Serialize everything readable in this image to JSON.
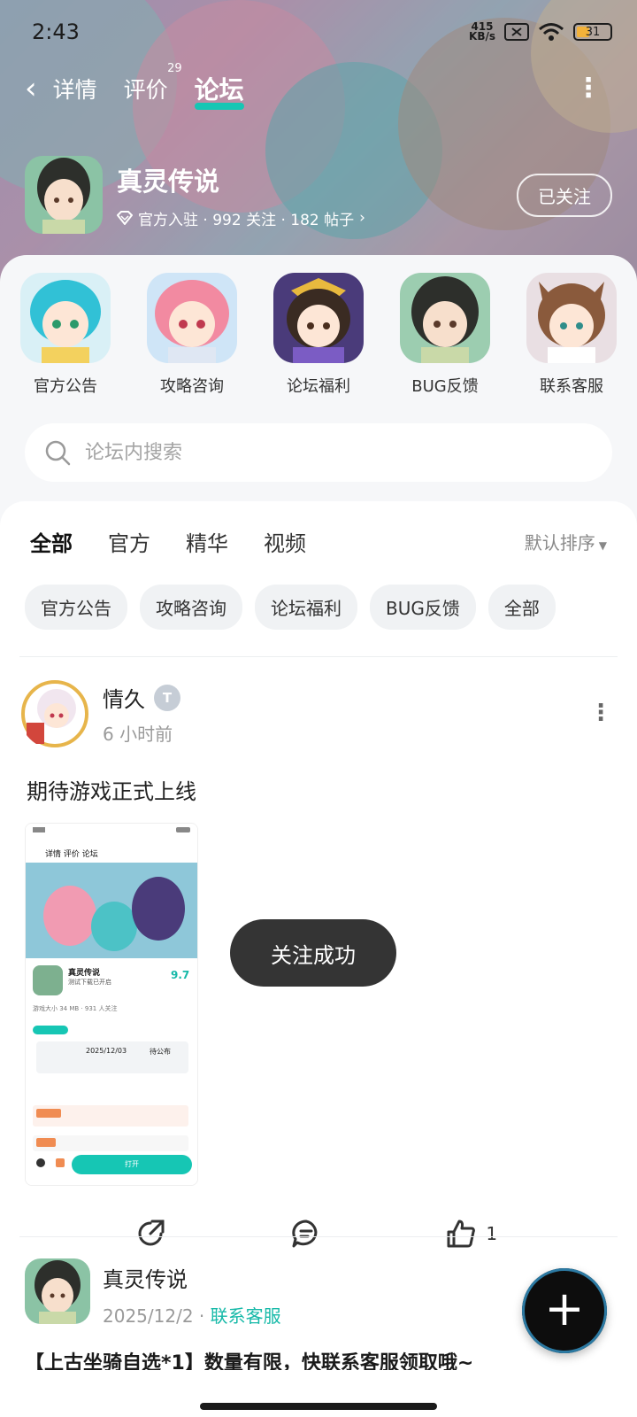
{
  "status_bar": {
    "time": "2:43",
    "net_speed_value": "415",
    "net_speed_unit": "KB/s",
    "battery": "31"
  },
  "nav": {
    "back_icon": "chevron-left-icon",
    "tabs": [
      {
        "label": "详情"
      },
      {
        "label": "评价",
        "count": "29"
      },
      {
        "label": "论坛",
        "active": true
      }
    ],
    "more_icon": "more-vertical-icon"
  },
  "game": {
    "title": "真灵传说",
    "meta": "官方入驻 · 992 关注 · 182 帖子",
    "follow_button": "已关注"
  },
  "categories": [
    {
      "label": "官方公告"
    },
    {
      "label": "攻略咨询"
    },
    {
      "label": "论坛福利"
    },
    {
      "label": "BUG反馈"
    },
    {
      "label": "联系客服"
    }
  ],
  "search": {
    "placeholder": "论坛内搜索"
  },
  "feed": {
    "tabs": [
      "全部",
      "官方",
      "精华",
      "视频"
    ],
    "sort_label": "默认排序",
    "chips": [
      "官方公告",
      "攻略咨询",
      "论坛福利",
      "BUG反馈",
      "全部"
    ]
  },
  "post1": {
    "author": "情久",
    "badge": "T",
    "time": "6 小时前",
    "text": "期待游戏正式上线",
    "like_count": "1",
    "screenshot": {
      "tabs": "详情  评价  论坛",
      "title": "真灵传说",
      "subtitle": "测试下载已开启",
      "score": "9.7",
      "size": "游戏大小 34 MB · 931 人关注",
      "date": "2025/12/03",
      "date_right": "待公布",
      "button": "打开"
    }
  },
  "toast": "关注成功",
  "post2": {
    "author": "真灵传说",
    "date": "2025/12/2",
    "link": "联系客服",
    "text": "【上古坐骑自选*1】数量有限，快联系客服领取哦~"
  },
  "colors": {
    "accent": "#16c6b4",
    "link": "#16b9a8"
  }
}
